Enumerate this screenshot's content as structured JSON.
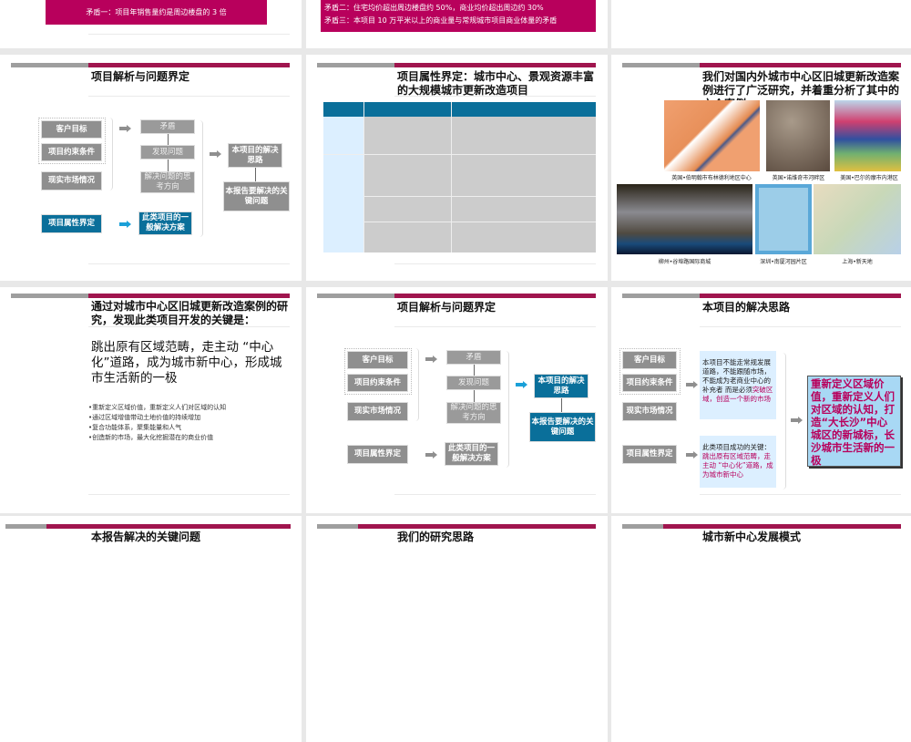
{
  "row1": {
    "left_banner": "矛盾一：项目年销售量约是周边楼盘的 3 倍",
    "mid_banner": [
      "矛盾二：住宅均价超出周边楼盘约 50%，商业均价超出周边约 30%",
      "矛盾三：本项目 10 万平米以上的商业量与常规城市项目商业体量的矛盾"
    ]
  },
  "flow": {
    "title": "项目解析与问题界定",
    "inputs": [
      "客户目标",
      "项目约束条件",
      "现实市场情况",
      "项目属性界定"
    ],
    "middle": [
      "矛盾",
      "发现问题",
      "解决问题的思考方向",
      "此类项目的一般解决方案"
    ],
    "right": [
      "本项目的解决思路",
      "本报告要解决的关键问题"
    ]
  },
  "attr_slide": {
    "title": "项目属性界定：城市中心、景观资源丰富的大规模城市更新改造项目"
  },
  "cases_slide": {
    "title": "我们对国内外城市中心区旧城更新改造案例进行了广泛研究，并着重分析了其中的六个案例",
    "captions": [
      "英国•伯明翰市布林德利地区中心",
      "英国•诺维奇市河畔区",
      "美国•巴尔的摩市内港区",
      "柳州•谷埠路国际商城",
      "深圳•南厦河园片区",
      "上海•新天地"
    ]
  },
  "key_slide": {
    "title": "通过对城市中心区旧城更新改造案例的研究，发现此类项目开发的关键是：",
    "headline": "跳出原有区域范畴，走主动 “中心化”道路，成为城市新中心，形成城市生活新的一极",
    "bullets": [
      "•重新定义区域价值，重新定义人们对区域的认知",
      "•通过区域增值带动土地价值的持续增加",
      "•复合功能体系，聚集能量和人气",
      "•创造新的市场，最大化挖掘潜在的商业价值"
    ]
  },
  "solution_slide": {
    "title": "本项目的解决思路",
    "box1_plain": "本项目不能走常规发展道路，不能跟随市场，不能成为老商业中心的补充者 而是必须",
    "box1_highlight": "突破区域，创造一个新的市场",
    "box2_plain": "此类项目成功的关键：",
    "box2_highlight": "跳出原有区域范畴，走主动 “中心化”道路，成为城市新中心",
    "conclusion": "重新定义区域价值，重新定义人们对区域的认知，打造“大长沙”中心城区的新城标，长沙城市生活新的一极"
  },
  "row4_titles": [
    "本报告解决的关键问题",
    "我们的研究思路",
    "城市新中心发展模式"
  ],
  "colors": {
    "magenta": "#a0154e",
    "blue": "#0a6f9a",
    "gray": "#8f8f8f"
  }
}
